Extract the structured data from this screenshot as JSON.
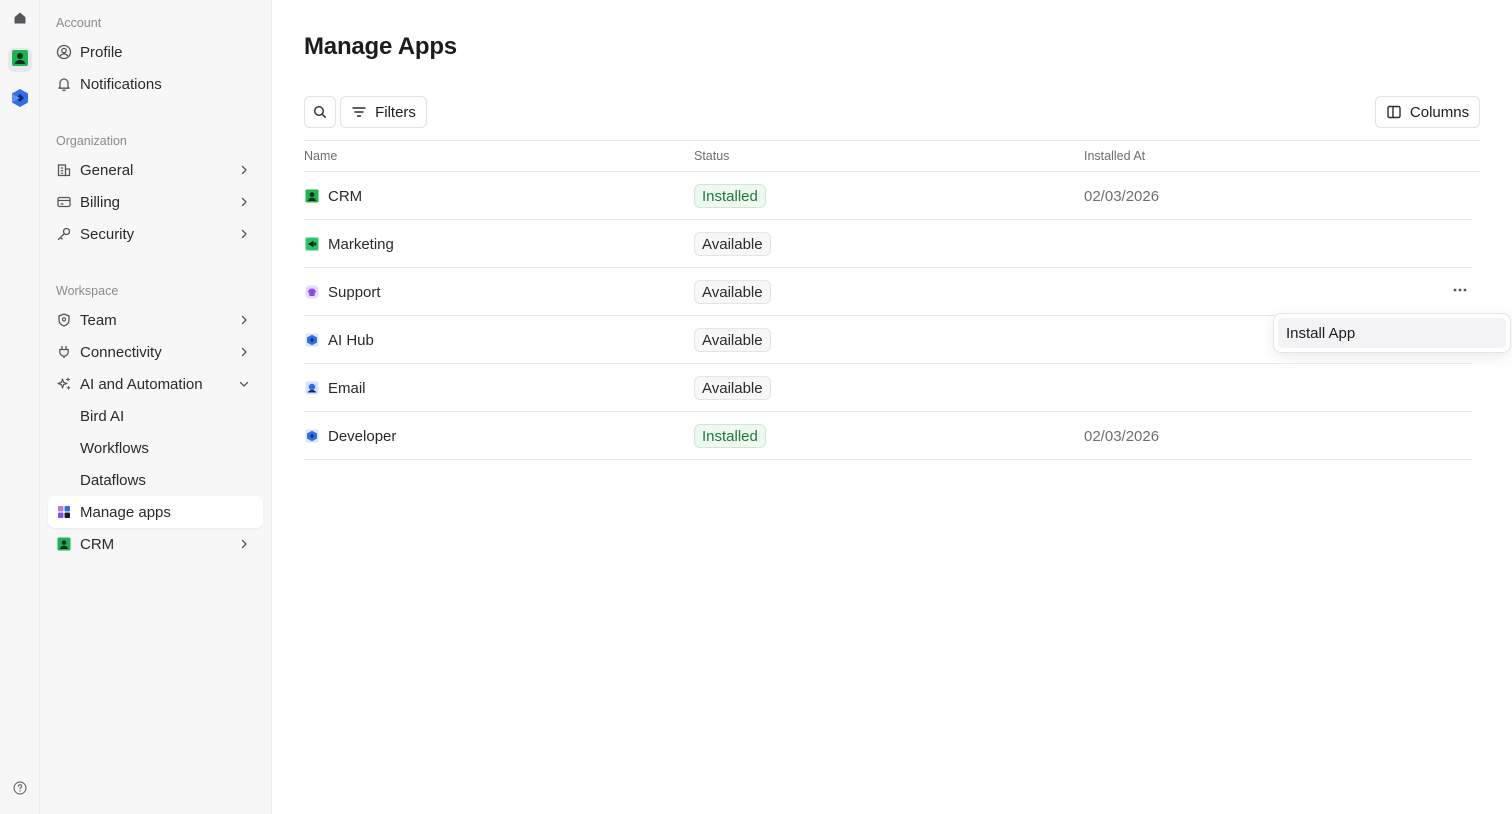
{
  "sidebar": {
    "account": {
      "title": "Account",
      "items": [
        {
          "label": "Profile"
        },
        {
          "label": "Notifications"
        }
      ]
    },
    "organization": {
      "title": "Organization",
      "items": [
        {
          "label": "General"
        },
        {
          "label": "Billing"
        },
        {
          "label": "Security"
        }
      ]
    },
    "workspace": {
      "title": "Workspace",
      "items": [
        {
          "label": "Team"
        },
        {
          "label": "Connectivity"
        },
        {
          "label": "AI and Automation"
        }
      ],
      "ai_children": [
        {
          "label": "Bird AI"
        },
        {
          "label": "Workflows"
        },
        {
          "label": "Dataflows"
        }
      ],
      "manage_apps": {
        "label": "Manage apps"
      },
      "crm": {
        "label": "CRM"
      }
    }
  },
  "main": {
    "title": "Manage Apps",
    "toolbar": {
      "filters_label": "Filters",
      "columns_label": "Columns"
    },
    "table": {
      "headers": {
        "name": "Name",
        "status": "Status",
        "installed_at": "Installed At"
      },
      "rows": [
        {
          "name": "CRM",
          "icon": "crm-icon",
          "status": "Installed",
          "installed_at": "02/03/2026"
        },
        {
          "name": "Marketing",
          "icon": "marketing-icon",
          "status": "Available",
          "installed_at": ""
        },
        {
          "name": "Support",
          "icon": "support-icon",
          "status": "Available",
          "installed_at": ""
        },
        {
          "name": "AI Hub",
          "icon": "ai-hub-icon",
          "status": "Available",
          "installed_at": ""
        },
        {
          "name": "Email",
          "icon": "email-icon",
          "status": "Available",
          "installed_at": ""
        },
        {
          "name": "Developer",
          "icon": "developer-icon",
          "status": "Installed",
          "installed_at": "02/03/2026"
        }
      ]
    },
    "context_menu": {
      "items": [
        {
          "label": "Install App"
        }
      ]
    }
  },
  "colors": {
    "installed_bg": "#eef8f0",
    "installed_text": "#1f7a3a",
    "crm_green": "#1fb34f",
    "brand_blue": "#2f6ee8",
    "support_purple": "#8a4fe0"
  }
}
